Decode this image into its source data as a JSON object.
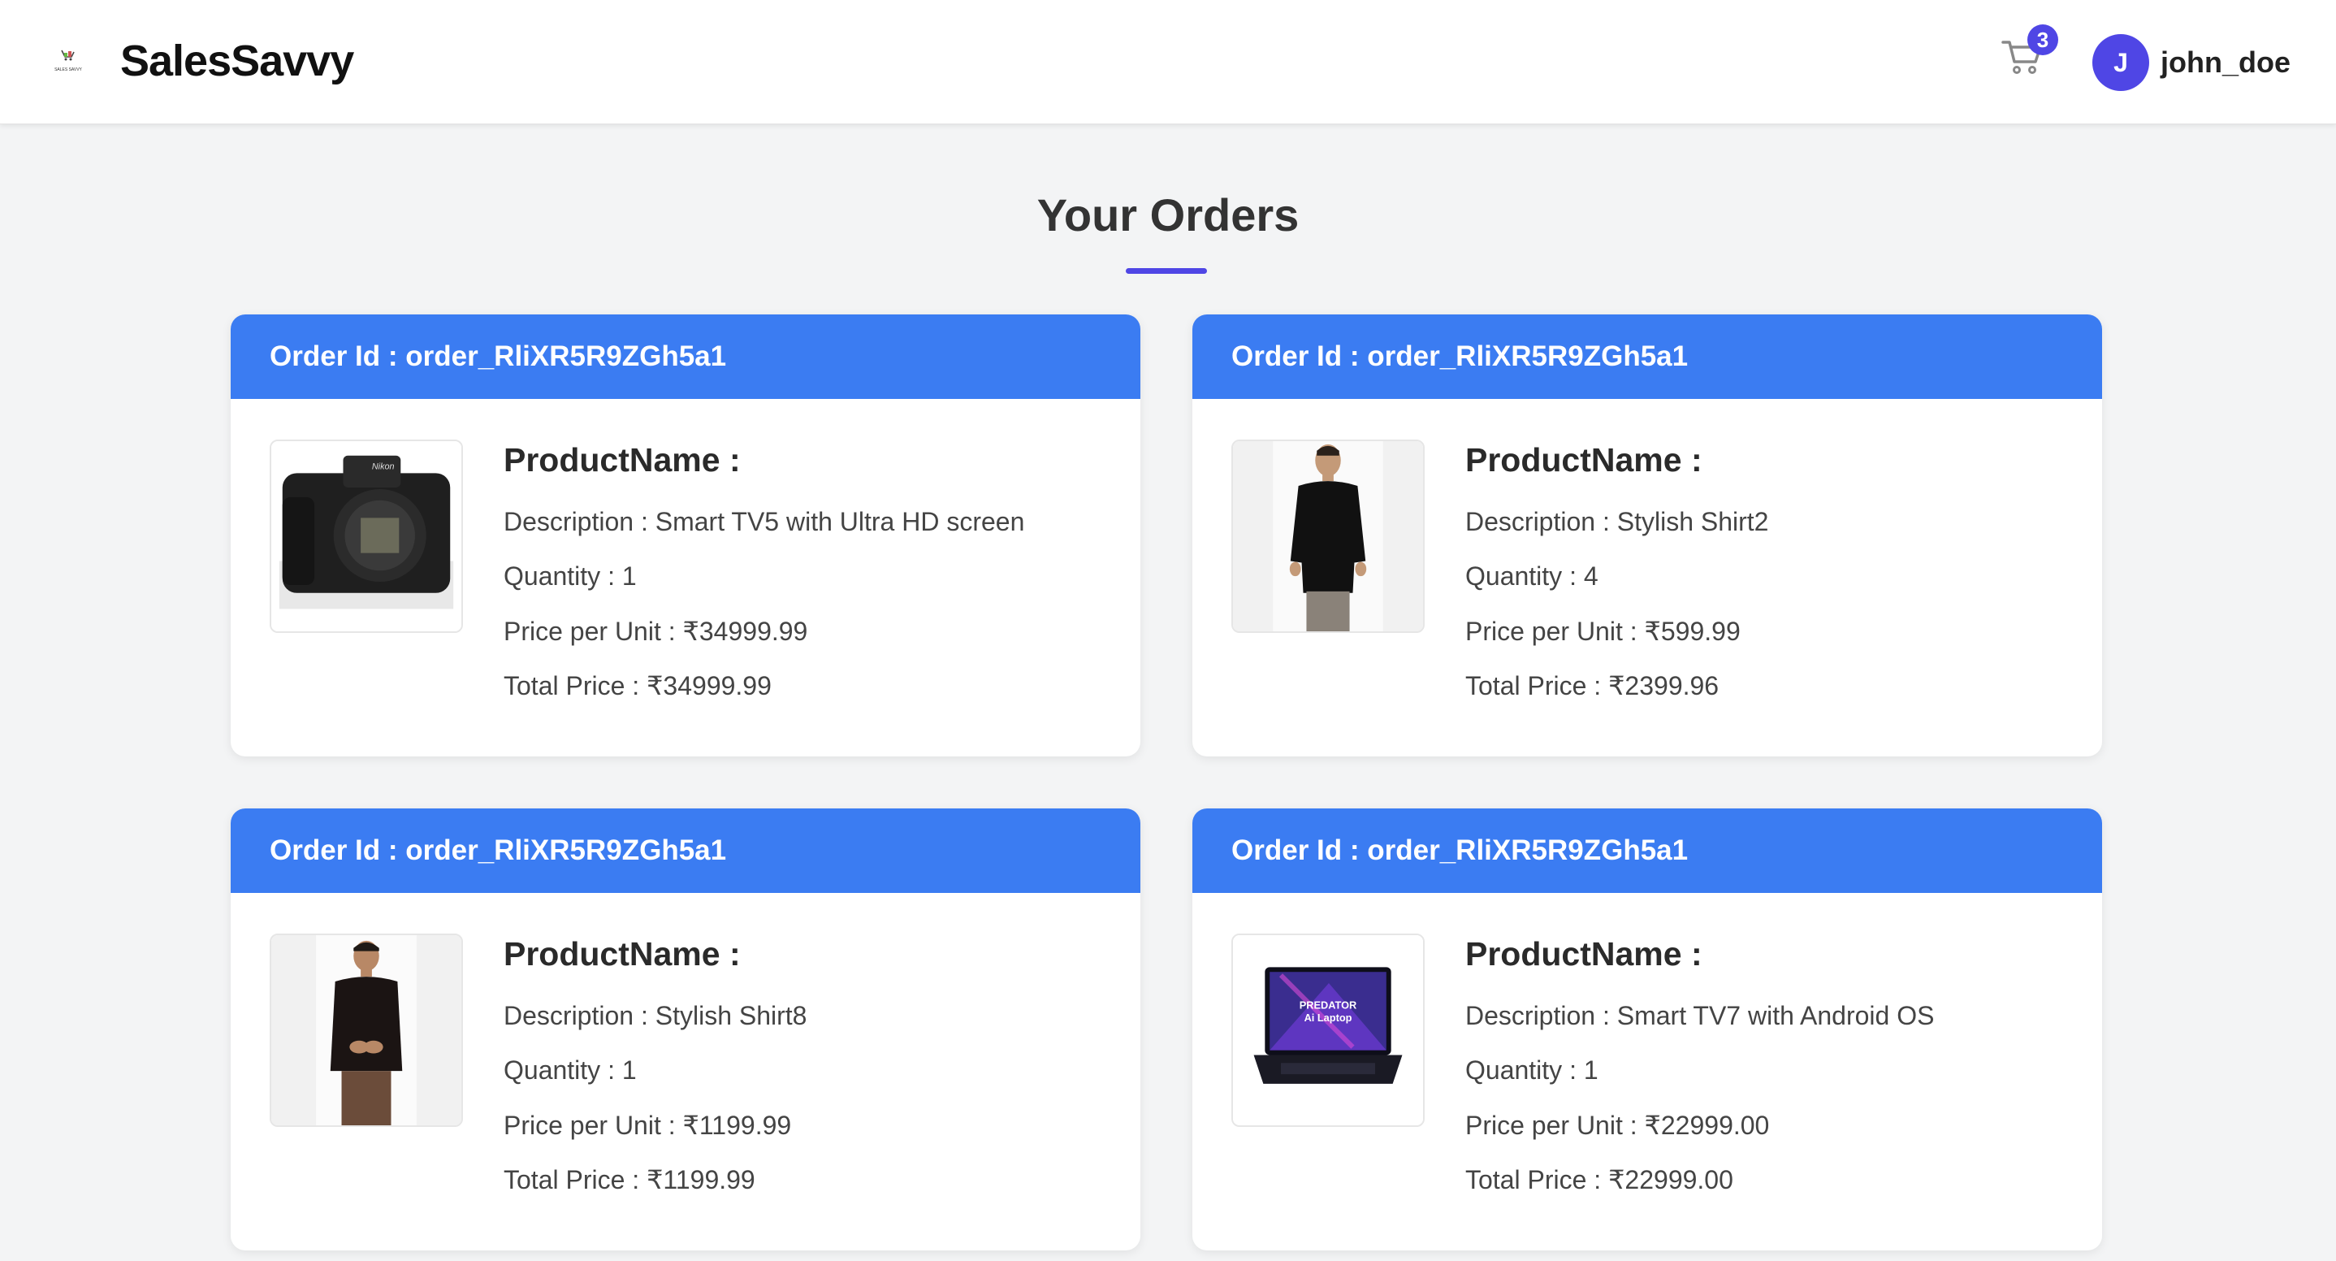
{
  "header": {
    "logo_text": "SALES SAVVY",
    "brand": "SalesSavvy",
    "cart_icon": "cart-icon",
    "cart_count": "3",
    "avatar_initial": "J",
    "username": "john_doe"
  },
  "page": {
    "title": "Your Orders"
  },
  "colors": {
    "accent": "#4f46e5",
    "card_header": "#3b7cf2",
    "background": "#f3f4f5"
  },
  "orders": [
    {
      "order_id": "Order Id : order_RliXR5R9ZGh5a1",
      "product_name": "ProductName :",
      "description": "Description : Smart TV5 with Ultra HD screen",
      "quantity": "Quantity : 1",
      "price_per_unit": "Price per Unit : ₹34999.99",
      "total_price": "Total Price : ₹34999.99",
      "image": "camera-image"
    },
    {
      "order_id": "Order Id : order_RliXR5R9ZGh5a1",
      "product_name": "ProductName :",
      "description": "Description : Stylish Shirt2",
      "quantity": "Quantity : 4",
      "price_per_unit": "Price per Unit : ₹599.99",
      "total_price": "Total Price : ₹2399.96",
      "image": "shirt-model-image"
    },
    {
      "order_id": "Order Id : order_RliXR5R9ZGh5a1",
      "product_name": "ProductName :",
      "description": "Description : Stylish Shirt8",
      "quantity": "Quantity : 1",
      "price_per_unit": "Price per Unit : ₹1199.99",
      "total_price": "Total Price : ₹1199.99",
      "image": "shirt-model-image"
    },
    {
      "order_id": "Order Id : order_RliXR5R9ZGh5a1",
      "product_name": "ProductName :",
      "description": "Description : Smart TV7 with Android OS",
      "quantity": "Quantity : 1",
      "price_per_unit": "Price per Unit : ₹22999.00",
      "total_price": "Total Price : ₹22999.00",
      "image": "laptop-image",
      "image_text": [
        "PREDATOR",
        "Ai Laptop"
      ]
    }
  ]
}
